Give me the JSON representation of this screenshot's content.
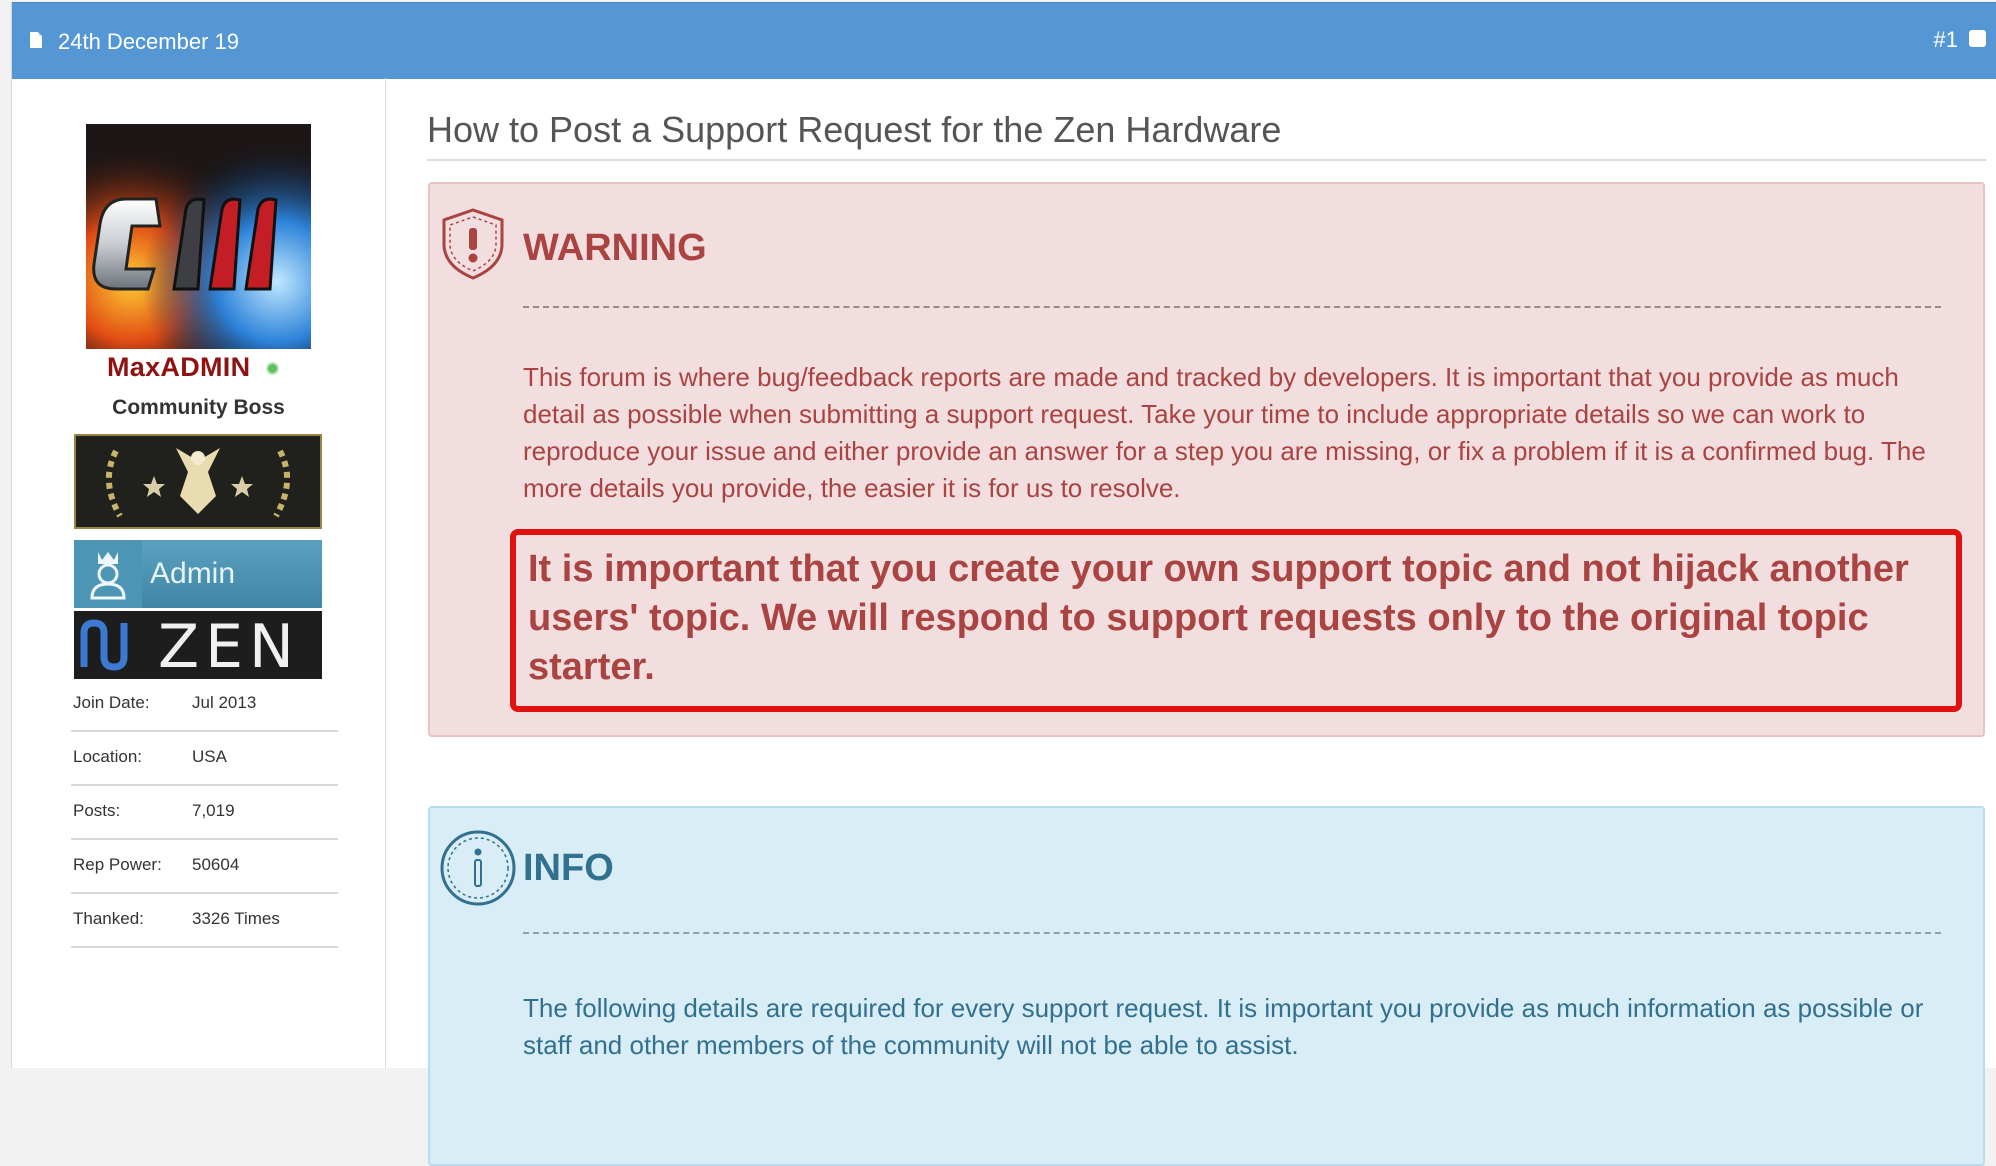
{
  "post_header": {
    "date": "24th December 19",
    "post_number": "#1"
  },
  "user": {
    "username": "MaxADMIN",
    "title": "Community Boss",
    "admin_badge": "Admin",
    "zen_badge": "ZEN",
    "stats": [
      {
        "label": "Join Date:",
        "value": "Jul 2013"
      },
      {
        "label": "Location:",
        "value": "USA"
      },
      {
        "label": "Posts:",
        "value": "7,019"
      },
      {
        "label": "Rep Power:",
        "value": "50604"
      },
      {
        "label": "Thanked:",
        "value": "3326 Times"
      }
    ]
  },
  "post": {
    "title": "How to Post a Support Request for the Zen Hardware",
    "warning": {
      "heading": "WARNING",
      "body": "This forum is where bug/feedback reports are made and tracked by developers. It is important that you provide as much detail as possible when submitting a support request. Take your time to include appropriate details so we can work to reproduce your issue and either provide an answer for a step you are missing, or fix a problem if it is a confirmed bug. The more details you provide, the easier it is for us to resolve.",
      "callout": "It is important that you create your own support topic and not hijack another users' topic. We will respond to support requests only to the original topic starter."
    },
    "info": {
      "heading": "INFO",
      "body": "The following details are required for every support request. It is important you provide as much information as possible or staff and other members of the community will not be able to assist."
    }
  },
  "colors": {
    "header_blue": "#5596d4",
    "warning_bg": "#f2dede",
    "warning_text": "#a94442",
    "callout_border": "#e0120f",
    "info_bg": "#d9edf7",
    "info_text": "#31708f",
    "username": "#8f1212"
  },
  "icons": [
    "document-icon",
    "select-post-checkbox",
    "online-status-icon",
    "shield-warning-icon",
    "info-circle-icon",
    "crown-user-icon",
    "zen-logo-icon",
    "eagle-rank-icon"
  ]
}
